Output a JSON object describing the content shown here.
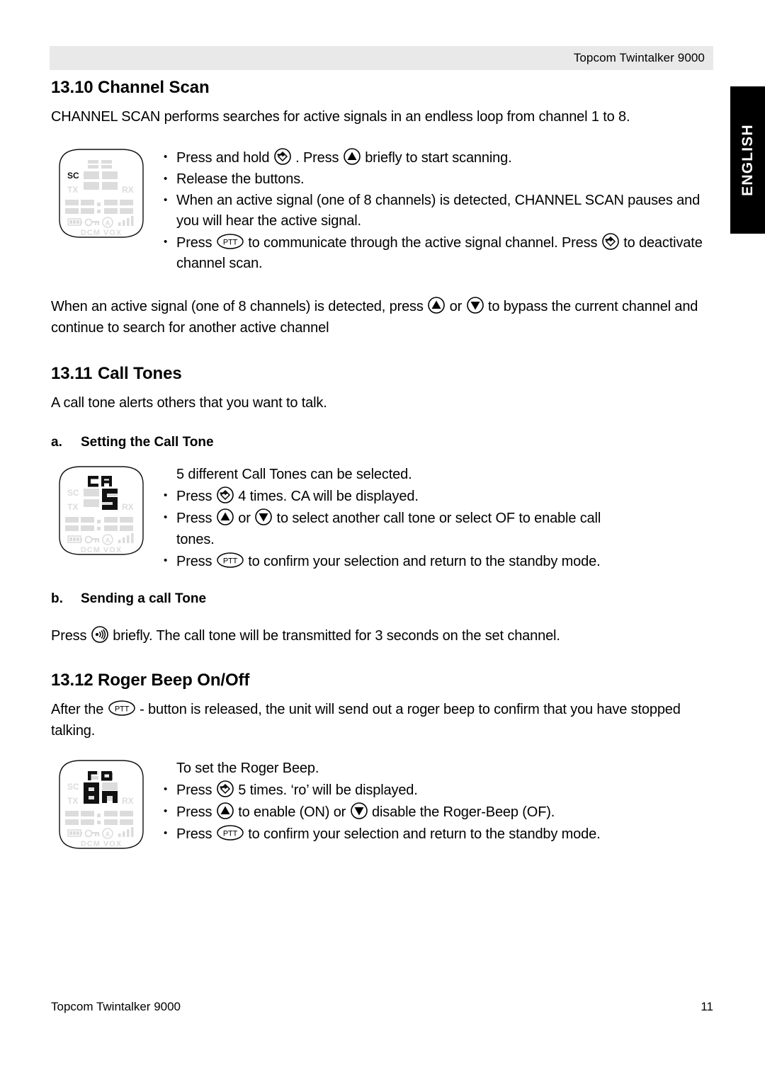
{
  "header": {
    "title": "Topcom Twintalker 9000"
  },
  "language_tab": {
    "label": "ENGLISH"
  },
  "sections": [
    {
      "number": "13.10",
      "title": "Channel Scan",
      "intro": "CHANNEL SCAN performs searches for active signals in an endless loop from channel 1 to 8.",
      "bullets": [
        "Press and hold  . Press  briefly to start scanning.",
        "Release the buttons.",
        "When an active signal (one of 8 channels) is detected, CHANNEL SCAN pauses and you will hear the active signal.",
        "Press  to communicate through the active signal channel. Press  to deactivate channel scan."
      ],
      "outro": "When an active signal (one of 8 channels) is detected, press  or  to bypass the current channel and continue to search for another active channel"
    },
    {
      "number": "13.11",
      "title": "Call Tones",
      "intro": "A call tone alerts others that you want to talk."
    },
    {
      "number": "13.12",
      "title": "Roger Beep On/Off"
    }
  ],
  "channel_scan": {
    "b1_pre": "Press and hold",
    "b1_mid": ". Press",
    "b1_post": "briefly to start scanning.",
    "b2": "Release the buttons.",
    "b3": "When an active signal (one of 8 channels) is detected, CHANNEL SCAN pauses and you will hear the active signal.",
    "b4_pre": "Press",
    "b4_mid": "to communicate through the active signal channel. Press",
    "b4_post": "to deactivate channel scan.",
    "outro_pre": "When an active signal (one of 8 channels) is detected, press",
    "outro_mid": "or",
    "outro_post": "to bypass the current channel and continue to search for another active channel"
  },
  "call_tone_setting": {
    "heading_letter": "a.",
    "heading_text": "Setting the Call Tone",
    "line1": "5 different Call Tones can be selected.",
    "b1_pre": "Press",
    "b1_post": "4 times. CA will be displayed.",
    "b2_pre": "Press",
    "b2_mid": "or",
    "b2_post": "to select another call tone or select OF to enable call",
    "b2_cont": "tones.",
    "b3_pre": "Press",
    "b3_post": "to confirm your selection and return to the standby mode."
  },
  "call_tone_sending": {
    "heading_letter": "b.",
    "heading_text": "Sending a call Tone",
    "line_pre": "Press",
    "line_post": "briefly. The call tone will be transmitted for 3 seconds on the set channel."
  },
  "roger_beep": {
    "intro_pre": "After the",
    "intro_post": "- button is released, the unit will send out a roger beep to confirm that you have stopped talking.",
    "line1": "To set the Roger Beep.",
    "b1_pre": "Press",
    "b1_post": "5 times. ‘ro’ will be displayed.",
    "b2_pre": "Press",
    "b2_mid": "to enable (ON) or",
    "b2_post": "disable the Roger-Beep (OF).",
    "b3_pre": "Press",
    "b3_post": "to confirm your selection and return to the standby mode."
  },
  "lcd_displays": [
    {
      "name": "channel-scan-display",
      "active_top": "",
      "active_main": "",
      "sc_active": true,
      "labels": {
        "sc": "SC",
        "tx": "TX",
        "rx": "RX",
        "dcm": "DCM",
        "vox": "VOX"
      },
      "segments_top": "88",
      "segments_main": "88",
      "segments_row1": "88:88",
      "segments_row2": "88:88"
    },
    {
      "name": "call-tone-display",
      "active_top": "CA",
      "active_main": "5",
      "sc_active": false,
      "labels": {
        "sc": "SC",
        "tx": "TX",
        "rx": "RX",
        "dcm": "DCM",
        "vox": "VOX"
      },
      "segments_top": "88",
      "segments_main": "88",
      "segments_row1": "88:88",
      "segments_row2": "88:88"
    },
    {
      "name": "roger-beep-display",
      "active_top": "ro",
      "active_main": "On",
      "sc_active": false,
      "labels": {
        "sc": "SC",
        "tx": "TX",
        "rx": "RX",
        "dcm": "DCM",
        "vox": "VOX"
      },
      "segments_top": "88",
      "segments_main": "88",
      "segments_row1": "88:88",
      "segments_row2": "88:88"
    }
  ],
  "icons": {
    "menu": "menu-scan-button-icon",
    "up": "up-arrow-button-icon",
    "down": "down-arrow-button-icon",
    "ptt": "ptt-button-icon",
    "call": "call-tone-button-icon",
    "ptt_label": "PTT"
  },
  "footer": {
    "left": "Topcom Twintalker 9000",
    "page_number": "11"
  },
  "colors": {
    "header_band": "#e9e9e9",
    "tab_background": "#000000",
    "tab_text": "#ffffff",
    "lcd_inactive": "#dcdcdc",
    "lcd_active": "#000000"
  }
}
